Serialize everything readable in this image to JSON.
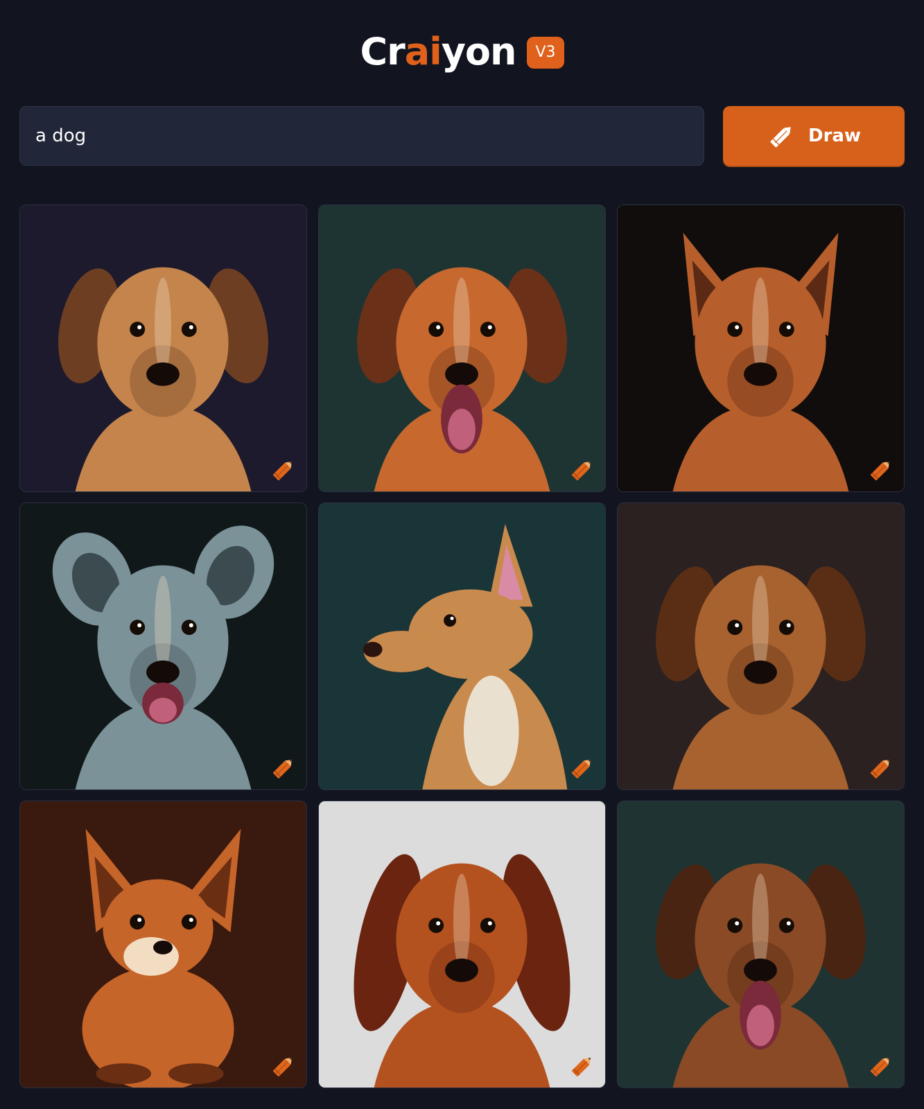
{
  "header": {
    "logo_prefix": "Cr",
    "logo_accent": "ai",
    "logo_suffix": "yon",
    "version": "V3"
  },
  "search": {
    "value": "a dog"
  },
  "draw_button": {
    "label": "Draw",
    "icon": "pencil-icon"
  },
  "colors": {
    "background": "#12151f",
    "accent": "#e0611c",
    "input_bg": "#212638"
  },
  "results": [
    {
      "subject": "dog-portrait",
      "bg": "#1c1a2c",
      "fur": "#c4844c",
      "dark": "#6e3e22",
      "variant": "floppy"
    },
    {
      "subject": "dog-portrait",
      "bg": "#1e3433",
      "fur": "#c7692f",
      "dark": "#6b3018",
      "variant": "floppy-open"
    },
    {
      "subject": "dog-portrait",
      "bg": "#110d0c",
      "fur": "#b75f2c",
      "dark": "#5c2a14",
      "variant": "pointy"
    },
    {
      "subject": "dog-portrait",
      "bg": "#10181a",
      "fur": "#7b9298",
      "dark": "#3b4b50",
      "variant": "bat-open"
    },
    {
      "subject": "dog-portrait",
      "bg": "#1a3537",
      "fur": "#c98a4d",
      "dark": "#7a4322",
      "variant": "profile"
    },
    {
      "subject": "dog-portrait",
      "bg": "#2a2120",
      "fur": "#a8622f",
      "dark": "#5a2e14",
      "variant": "floppy"
    },
    {
      "subject": "dog-portrait",
      "bg": "#3a1a0e",
      "fur": "#c6652a",
      "dark": "#6a2e12",
      "variant": "sitting"
    },
    {
      "subject": "dog-portrait",
      "bg": "#dcdcdc",
      "fur": "#b4521f",
      "dark": "#6a2410",
      "variant": "floppy-long"
    },
    {
      "subject": "dog-portrait",
      "bg": "#1f3432",
      "fur": "#8a4a26",
      "dark": "#4a2412",
      "variant": "floppy-open"
    }
  ]
}
